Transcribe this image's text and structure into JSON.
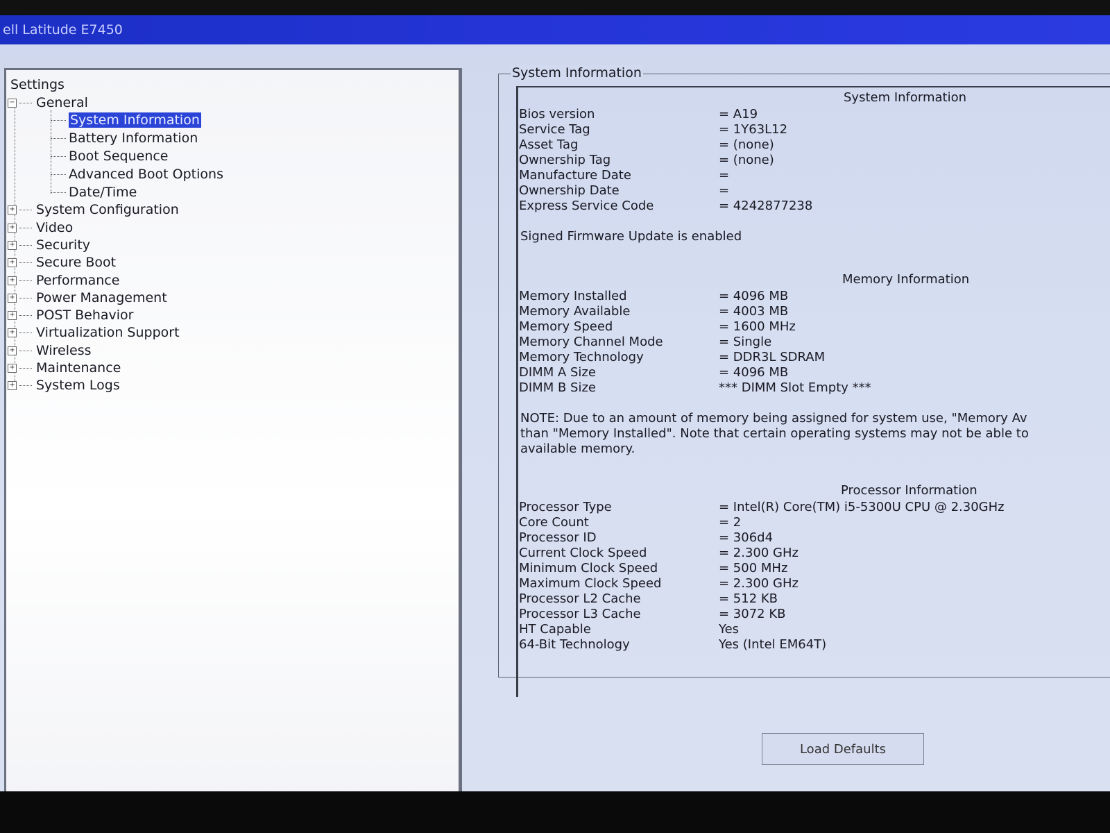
{
  "window": {
    "title": "ell Latitude E7450"
  },
  "tree": {
    "root": "Settings",
    "general": {
      "label": "General",
      "children": [
        "System Information",
        "Battery Information",
        "Boot Sequence",
        "Advanced Boot Options",
        "Date/Time"
      ]
    },
    "nodes": [
      "System Configuration",
      "Video",
      "Security",
      "Secure Boot",
      "Performance",
      "Power Management",
      "POST Behavior",
      "Virtualization Support",
      "Wireless",
      "Maintenance",
      "System Logs"
    ]
  },
  "group_legend": "System Information",
  "system": {
    "heading": "System Information",
    "rows": [
      {
        "k": "Bios version",
        "v": "= A19"
      },
      {
        "k": "Service Tag",
        "v": "= 1Y63L12"
      },
      {
        "k": "Asset Tag",
        "v": "= (none)"
      },
      {
        "k": "Ownership Tag",
        "v": "= (none)"
      },
      {
        "k": "Manufacture Date",
        "v": "="
      },
      {
        "k": "Ownership Date",
        "v": "="
      },
      {
        "k": "Express Service Code",
        "v": "= 4242877238"
      }
    ],
    "firmware_note": "Signed Firmware Update is enabled"
  },
  "memory": {
    "heading": "Memory Information",
    "rows": [
      {
        "k": "Memory Installed",
        "v": "= 4096 MB"
      },
      {
        "k": "Memory Available",
        "v": "= 4003 MB"
      },
      {
        "k": "Memory Speed",
        "v": "= 1600 MHz"
      },
      {
        "k": "Memory Channel Mode",
        "v": "= Single"
      },
      {
        "k": "Memory Technology",
        "v": "= DDR3L SDRAM"
      },
      {
        "k": "DIMM A Size",
        "v": "= 4096 MB"
      },
      {
        "k": "DIMM B Size",
        "v": "*** DIMM Slot Empty ***"
      }
    ],
    "note_lines": [
      "NOTE: Due to an amount of memory being assigned for system use, \"Memory Av",
      "than \"Memory Installed\". Note that certain operating systems may not be able to",
      "available memory."
    ]
  },
  "processor": {
    "heading": "Processor Information",
    "rows": [
      {
        "k": "Processor Type",
        "v": "= Intel(R) Core(TM) i5-5300U CPU @ 2.30GHz"
      },
      {
        "k": "Core Count",
        "v": "= 2"
      },
      {
        "k": "Processor ID",
        "v": "= 306d4"
      },
      {
        "k": "Current Clock Speed",
        "v": "= 2.300 GHz"
      },
      {
        "k": "Minimum Clock Speed",
        "v": "= 500 MHz"
      },
      {
        "k": "Maximum Clock Speed",
        "v": "= 2.300 GHz"
      },
      {
        "k": "Processor L2 Cache",
        "v": "= 512 KB"
      },
      {
        "k": "Processor L3 Cache",
        "v": "= 3072 KB"
      },
      {
        "k": "HT Capable",
        "v": "Yes"
      },
      {
        "k": "64-Bit Technology",
        "v": "Yes (Intel EM64T)"
      }
    ]
  },
  "buttons": {
    "load_defaults": "Load Defaults"
  }
}
